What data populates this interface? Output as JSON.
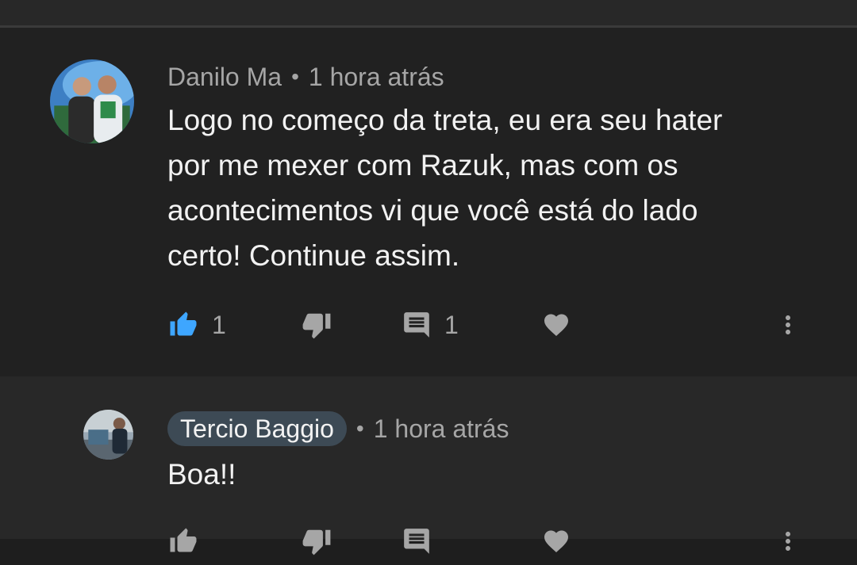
{
  "comments": [
    {
      "author": "Danilo Ma",
      "separator": "•",
      "time": "1 hora atrás",
      "text": "Logo no começo da treta, eu era seu hater\npor me mexer com Razuk, mas com os\nacontecimentos vi que você está do lado\ncerto! Continue assim.",
      "likes": "1",
      "replies": "1"
    },
    {
      "author": "Tercio Baggio",
      "separator": "•",
      "time": "1 hora atrás",
      "text": "Boa!!"
    }
  ],
  "icons": {
    "like": "thumbs-up-icon",
    "dislike": "thumbs-down-icon",
    "reply": "comment-icon",
    "heart": "heart-icon",
    "more": "more-vert-icon"
  },
  "colors": {
    "background": "#212121",
    "reply_background": "#282828",
    "like_active": "#3ea6ff",
    "muted_text": "#a6a6a6",
    "author_chip": "#3d4a55"
  }
}
